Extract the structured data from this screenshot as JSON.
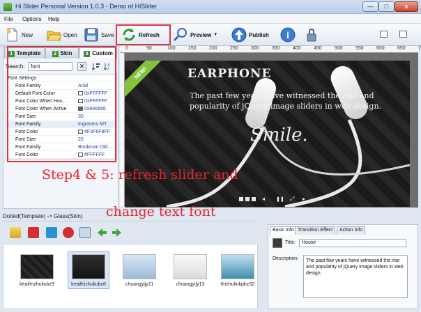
{
  "window": {
    "title": "Hi Slider Personal Version 1.0.3    -  Demo of HiSlider",
    "minimize_label": "—",
    "maximize_label": "□",
    "close_label": "x"
  },
  "menu": {
    "items": [
      "File",
      "Options",
      "Help"
    ]
  },
  "toolbar": {
    "new_label": "New",
    "open_label": "Open",
    "save_label": "Save",
    "refresh_label": "Refresh",
    "preview_label": "Preview",
    "publish_label": "Publish",
    "preview_dropdown_label": "▼",
    "info_label": "i"
  },
  "left_panel": {
    "tabs": [
      {
        "num": "1",
        "label": "Template"
      },
      {
        "num": "2",
        "label": "Skin"
      },
      {
        "num": "3",
        "label": "Custom"
      }
    ],
    "search_label": "Search:",
    "search_value": "font",
    "search_clear_label": "✕",
    "properties": [
      {
        "name": "Font Settings",
        "value": "",
        "group": true
      },
      {
        "name": "Font Family",
        "value": "Arial",
        "group": false
      },
      {
        "name": "Default Font Color",
        "value": "0xFFFFFF",
        "group": false,
        "color": "#FFFFFF"
      },
      {
        "name": "Font Color When Hov...",
        "value": "0xFFFFFF",
        "group": false,
        "color": "#FFFFFF"
      },
      {
        "name": "Font Color When Active",
        "value": "0x666666",
        "group": false,
        "color": "#666666"
      },
      {
        "name": "Font Size",
        "value": "30",
        "group": false
      },
      {
        "name": "Font Family",
        "value": "Ingravers MT",
        "group": false,
        "selected": true
      },
      {
        "name": "Font Color",
        "value": "#F3F6F8FF",
        "group": false,
        "color": "#F3F6F8"
      },
      {
        "name": "Font Size",
        "value": "20",
        "group": false
      },
      {
        "name": "Font Family",
        "value": "Bookman Old ...",
        "group": false
      },
      {
        "name": "Font Color",
        "value": "#FFFFFF",
        "group": false,
        "color": "#FFFFFF"
      }
    ]
  },
  "breadcrumb": "Dotted(Template) -> Glass(Skin)",
  "ruler": {
    "ticks": [
      "0",
      "50",
      "100",
      "150",
      "200",
      "250",
      "300",
      "350",
      "400",
      "450",
      "500",
      "550",
      "600",
      "650",
      "700"
    ]
  },
  "slide": {
    "title": "EARPHONE",
    "description": "The past few years have witnessed the rise and popularity of jQuery image sliders in web design.",
    "tagline": "Smile.",
    "ribbon": "NEW!",
    "controls": [
      "◂",
      "❚❚",
      "⤢",
      "▸"
    ]
  },
  "annotation": {
    "line1": "Step4 & 5: refresh slider and",
    "line2": "change text font"
  },
  "thumbnails": [
    {
      "label": "keaifeizhuliubz9"
    },
    {
      "label": "keaifeizhuliubz6"
    },
    {
      "label": "chuangyijy11"
    },
    {
      "label": "chuangyijy13"
    },
    {
      "label": "feizhuliukpbz32"
    }
  ],
  "info_panel": {
    "tabs": [
      "Basic Info",
      "Transition Effect",
      "Action Info"
    ],
    "title_label": "Title:",
    "title_value": "House",
    "description_label": "Description:",
    "description_value": "The past few years have witnessed the rise and popularity of jQuery image sliders in web design."
  },
  "colors": {
    "highlight_red": "#e0303a",
    "ribbon_green": "#84c23a",
    "accent_blue": "#2a3fb0"
  }
}
